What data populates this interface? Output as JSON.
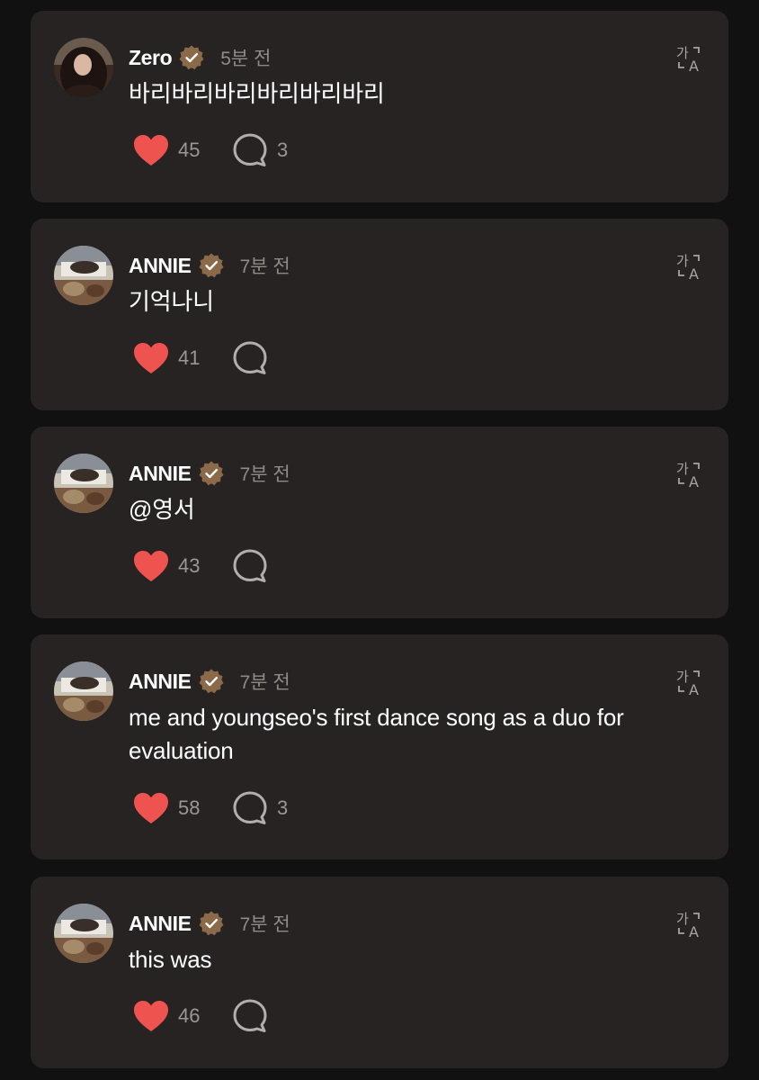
{
  "colors": {
    "background": "#111111",
    "card": "#262322",
    "heart": "#ef5350",
    "badge": "#8b6a4a",
    "muted_text": "#8f8a87"
  },
  "comments": [
    {
      "author": "Zero",
      "time": "5분 전",
      "text": "바리바리바리바리바리바리",
      "likes": "45",
      "replies": "3",
      "verified": true,
      "avatar": "zero-avatar"
    },
    {
      "author": "ANNIE",
      "time": "7분 전",
      "text": "기억나니",
      "likes": "41",
      "replies": "",
      "verified": true,
      "avatar": "annie-avatar"
    },
    {
      "author": "ANNIE",
      "time": "7분 전",
      "text": "@영서",
      "likes": "43",
      "replies": "",
      "verified": true,
      "avatar": "annie-avatar"
    },
    {
      "author": "ANNIE",
      "time": "7분 전",
      "text": "me and youngseo's first dance song as a duo for evaluation",
      "likes": "58",
      "replies": "3",
      "verified": true,
      "avatar": "annie-avatar"
    },
    {
      "author": "ANNIE",
      "time": "7분 전",
      "text": "this was",
      "likes": "46",
      "replies": "",
      "verified": true,
      "avatar": "annie-avatar"
    }
  ],
  "icons": {
    "verified": "verified-badge-icon",
    "translate": "translate-icon",
    "like": "heart-icon",
    "reply": "comment-bubble-icon"
  }
}
